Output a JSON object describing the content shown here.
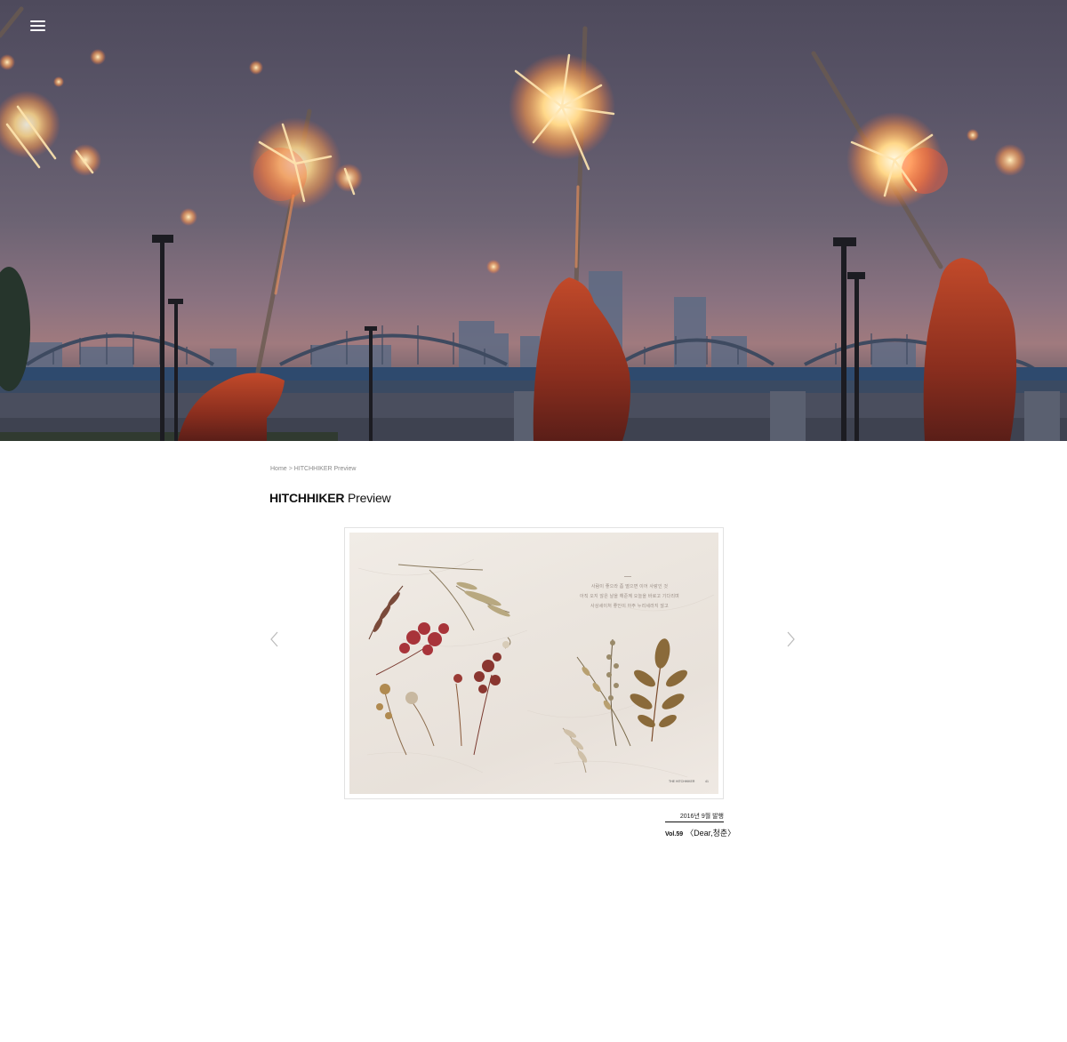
{
  "header": {
    "menu_icon": "hamburger-menu-icon",
    "hero_image": "sparklers-at-dusk-over-river-bridge"
  },
  "breadcrumb": {
    "home": "Home",
    "separator": ">",
    "current": "HITCHHIKER Preview"
  },
  "page_title": {
    "strong": "HITCHHIKER",
    "light": "Preview"
  },
  "carousel": {
    "prev_icon": "chevron-left-icon",
    "next_icon": "chevron-right-icon",
    "slide_image": "pressed-dried-flowers-magazine-spread",
    "slide_poem_lines": [
      "사람이 좋으라 좀 떨으면 이어 사랑인 것",
      "아직 오지 않은 날을 해준께 오늘을 바로고 기다리며",
      "사상세이처 좋인이 아주 누리세라지 않고"
    ],
    "slide_footer_logo": "THE HITCHHIKER",
    "slide_page_number": "41"
  },
  "issue": {
    "date": "2016년 9월 발행",
    "volume": "Vol.59",
    "title": "〈Dear,청춘〉"
  },
  "colors": {
    "text": "#111111",
    "muted": "#888888",
    "frame_border": "#e2e2e2",
    "arrow": "#bbbbbb"
  }
}
